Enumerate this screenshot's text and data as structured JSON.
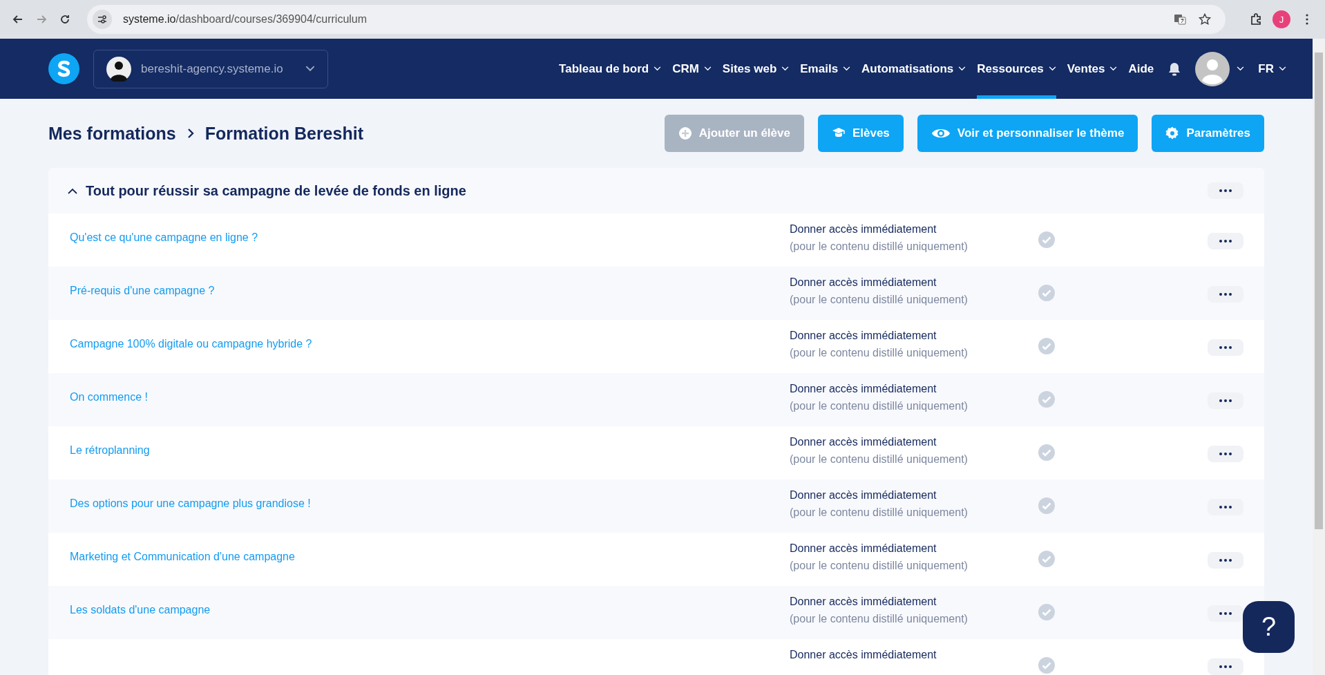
{
  "browser": {
    "url_host": "systeme.io",
    "url_path": "/dashboard/courses/369904/curriculum",
    "profile_initial": "J"
  },
  "nav": {
    "account": "bereshit-agency.systeme.io",
    "items": [
      {
        "label": "Tableau de bord",
        "selected": false,
        "dropdown": true
      },
      {
        "label": "CRM",
        "selected": false,
        "dropdown": true
      },
      {
        "label": "Sites web",
        "selected": false,
        "dropdown": true
      },
      {
        "label": "Emails",
        "selected": false,
        "dropdown": true
      },
      {
        "label": "Automatisations",
        "selected": false,
        "dropdown": true
      },
      {
        "label": "Ressources",
        "selected": true,
        "dropdown": true
      },
      {
        "label": "Ventes",
        "selected": false,
        "dropdown": true
      },
      {
        "label": "Aide",
        "selected": false,
        "dropdown": false
      }
    ],
    "language": "FR"
  },
  "breadcrumb": [
    "Mes formations",
    "Formation Bereshit"
  ],
  "actions": [
    {
      "label": "Ajouter un élève",
      "kind": "add",
      "disabled": true
    },
    {
      "label": "Elèves",
      "kind": "students",
      "disabled": false
    },
    {
      "label": "Voir et personnaliser le thème",
      "kind": "view",
      "disabled": false
    },
    {
      "label": "Paramètres",
      "kind": "settings",
      "disabled": false
    }
  ],
  "module": {
    "title": "Tout pour réussir sa campagne de levée de fonds en ligne",
    "expanded": true,
    "lessons": [
      {
        "title": "Qu'est ce qu'une campagne en ligne ?",
        "access": "Donner accès immédiatement",
        "note": "(pour le contenu distillé uniquement)"
      },
      {
        "title": "Pré-requis d'une campagne ?",
        "access": "Donner accès immédiatement",
        "note": "(pour le contenu distillé uniquement)"
      },
      {
        "title": "Campagne 100% digitale ou campagne hybride ?",
        "access": "Donner accès immédiatement",
        "note": "(pour le contenu distillé uniquement)"
      },
      {
        "title": "On commence !",
        "access": "Donner accès immédiatement",
        "note": "(pour le contenu distillé uniquement)"
      },
      {
        "title": "Le rétroplanning",
        "access": "Donner accès immédiatement",
        "note": "(pour le contenu distillé uniquement)"
      },
      {
        "title": "Des options pour une campagne plus grandiose !",
        "access": "Donner accès immédiatement",
        "note": "(pour le contenu distillé uniquement)"
      },
      {
        "title": "Marketing et Communication d'une campagne",
        "access": "Donner accès immédiatement",
        "note": "(pour le contenu distillé uniquement)"
      },
      {
        "title": "Les soldats d'une campagne",
        "access": "Donner accès immédiatement",
        "note": "(pour le contenu distillé uniquement)"
      },
      {
        "access": "Donner accès immédiatement"
      }
    ]
  },
  "help": "?"
}
